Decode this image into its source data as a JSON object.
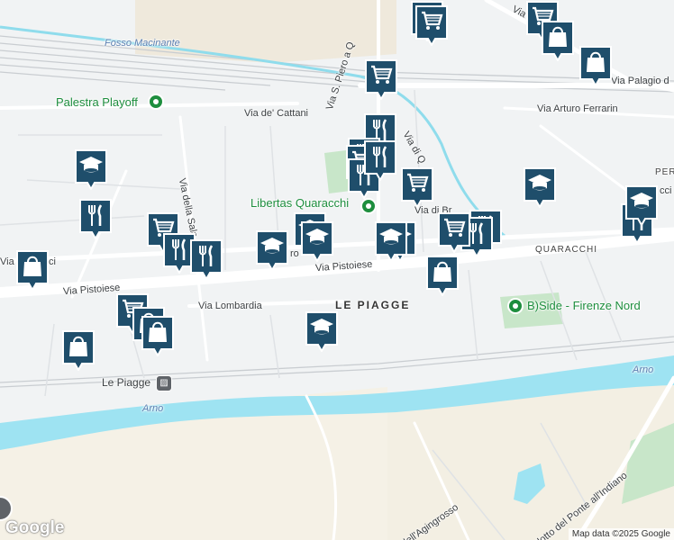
{
  "map": {
    "colors": {
      "water": "#9ee3f2",
      "road": "#ffffff",
      "park": "#c8e6c9",
      "land": "#f1f3f4",
      "marker": "#1f4e6b",
      "poi": "#1e8e3e"
    },
    "labels": {
      "fosso": "Fosso Macinante",
      "via_pra": "Via Pra",
      "via_palagio": "Via Palagio d",
      "via_arturo": "Via Arturo Ferrarin",
      "via_cattani": "Via de' Cattani",
      "via_s_piero": "Via S. Piero a Q",
      "via_di_q": "Via di Q",
      "via_della_sala": "Via della Sala",
      "via_di_br": "Via di Br",
      "via_pistoiese_1": "Via Pistoiese",
      "via_pistoiese_2": "Via Pistoiese",
      "via_lombardia": "Via Lombardia",
      "le_piagge": "LE PIAGGE",
      "quaracchi": "QUARACCHI",
      "peri": "PERI",
      "cci": "cci",
      "arno_1": "Arno",
      "arno_2": "Arno",
      "via_i": "Via I",
      "via_cci": "ci",
      "ro": "ro",
      "agingrosso": "dell'Agingrosso",
      "ponte": "dotto del Ponte all'Indiano",
      "ponte_end": "V"
    },
    "pois": {
      "palestra": "Palestra Playoff",
      "libertas": "Libertas Quaracchi",
      "bside": "B)Side - Firenze Nord"
    },
    "station": {
      "name": "Le Piagge",
      "icon": "train-icon"
    },
    "markers": [
      {
        "type": "cart",
        "icon": "shopping-cart-icon"
      },
      {
        "type": "cart",
        "icon": "shopping-cart-icon"
      },
      {
        "type": "cart",
        "icon": "shopping-cart-icon"
      },
      {
        "type": "bag",
        "icon": "shopping-bag-icon"
      },
      {
        "type": "bag",
        "icon": "shopping-bag-icon"
      },
      {
        "type": "cart",
        "icon": "shopping-cart-icon"
      },
      {
        "type": "food",
        "icon": "restaurant-icon"
      },
      {
        "type": "food",
        "icon": "restaurant-icon"
      },
      {
        "type": "school",
        "icon": "school-icon"
      },
      {
        "type": "cart",
        "icon": "shopping-cart-icon"
      },
      {
        "type": "food",
        "icon": "restaurant-icon"
      },
      {
        "type": "school",
        "icon": "school-icon"
      },
      {
        "type": "food",
        "icon": "restaurant-icon"
      },
      {
        "type": "cart",
        "icon": "shopping-cart-icon"
      },
      {
        "type": "food",
        "icon": "restaurant-icon"
      },
      {
        "type": "food",
        "icon": "restaurant-icon"
      },
      {
        "type": "school",
        "icon": "school-icon"
      },
      {
        "type": "school",
        "icon": "school-icon"
      },
      {
        "type": "school",
        "icon": "school-icon"
      },
      {
        "type": "school",
        "icon": "school-icon"
      },
      {
        "type": "cart",
        "icon": "shopping-cart-icon"
      },
      {
        "type": "food",
        "icon": "restaurant-icon"
      },
      {
        "type": "food",
        "icon": "restaurant-icon"
      },
      {
        "type": "food",
        "icon": "restaurant-icon"
      },
      {
        "type": "bag",
        "icon": "shopping-bag-icon"
      },
      {
        "type": "school",
        "icon": "school-icon"
      },
      {
        "type": "school",
        "icon": "school-icon"
      },
      {
        "type": "food",
        "icon": "restaurant-icon"
      },
      {
        "type": "bag",
        "icon": "shopping-bag-icon"
      },
      {
        "type": "cart",
        "icon": "shopping-cart-icon"
      },
      {
        "type": "cart",
        "icon": "shopping-cart-icon"
      },
      {
        "type": "bag",
        "icon": "shopping-bag-icon"
      },
      {
        "type": "bag",
        "icon": "shopping-bag-icon"
      },
      {
        "type": "school",
        "icon": "school-icon"
      },
      {
        "type": "bag",
        "icon": "shopping-bag-icon"
      }
    ],
    "google": "Google",
    "attribution": "Map data ©2025 Google"
  }
}
